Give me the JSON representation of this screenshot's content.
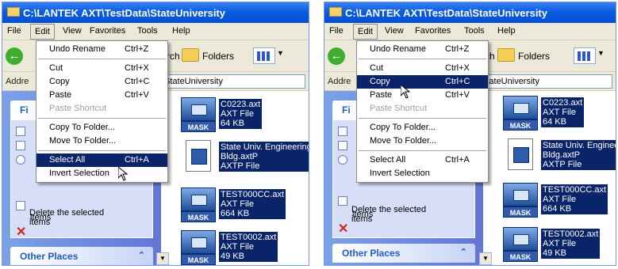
{
  "window": {
    "title": "C:\\LANTEK AXT\\TestData\\StateUniversity"
  },
  "menubar": {
    "items": [
      "File",
      "Edit",
      "View",
      "Favorites",
      "Tools",
      "Help"
    ]
  },
  "toolbar": {
    "search_partial": "rch",
    "folders_label": "Folders"
  },
  "address": {
    "label_partial_left": "Addre",
    "label_partial_right": "Addre",
    "value_partial": "StateUniversity"
  },
  "taskpane": {
    "file_tasks_partial": "Fi",
    "items_text": "items",
    "delete_line1": "Delete the selected",
    "delete_line2": "items",
    "other_places": "Other Places"
  },
  "files": [
    {
      "name": "C0223.axt",
      "type": "AXT File",
      "size": "64 KB",
      "icon": "mask-file-icon"
    },
    {
      "name": "State Univ. Engineering",
      "name_line2": "Bldg.axtP",
      "type": "AXTP File",
      "icon": "axtp-file-icon"
    },
    {
      "name": "TEST000CC.axt",
      "type": "AXT File",
      "size": "664 KB",
      "icon": "mask-file-icon"
    },
    {
      "name": "TEST0002.axt",
      "type": "AXT File",
      "size": "49 KB",
      "icon": "mask-file-icon"
    }
  ],
  "files_right": {
    "name2_line1": "State Univ. Enginee",
    "name2_line2": "Bldg.axtP"
  },
  "edit_menu": {
    "undo": "Undo Rename",
    "undo_sc": "Ctrl+Z",
    "cut": "Cut",
    "cut_sc": "Ctrl+X",
    "copy": "Copy",
    "copy_sc": "Ctrl+C",
    "paste": "Paste",
    "paste_sc": "Ctrl+V",
    "paste_shortcut": "Paste Shortcut",
    "copy_to": "Copy To Folder...",
    "move_to": "Move To Folder...",
    "select_all": "Select All",
    "select_all_sc": "Ctrl+A",
    "invert": "Invert Selection"
  },
  "state": {
    "left_highlighted": "Select All",
    "right_highlighted": "Copy"
  },
  "colors": {
    "titlebar": "#0a5ee0",
    "selection": "#0a246a",
    "menubar": "#ece9d8",
    "taskpane": "#6375d6"
  }
}
